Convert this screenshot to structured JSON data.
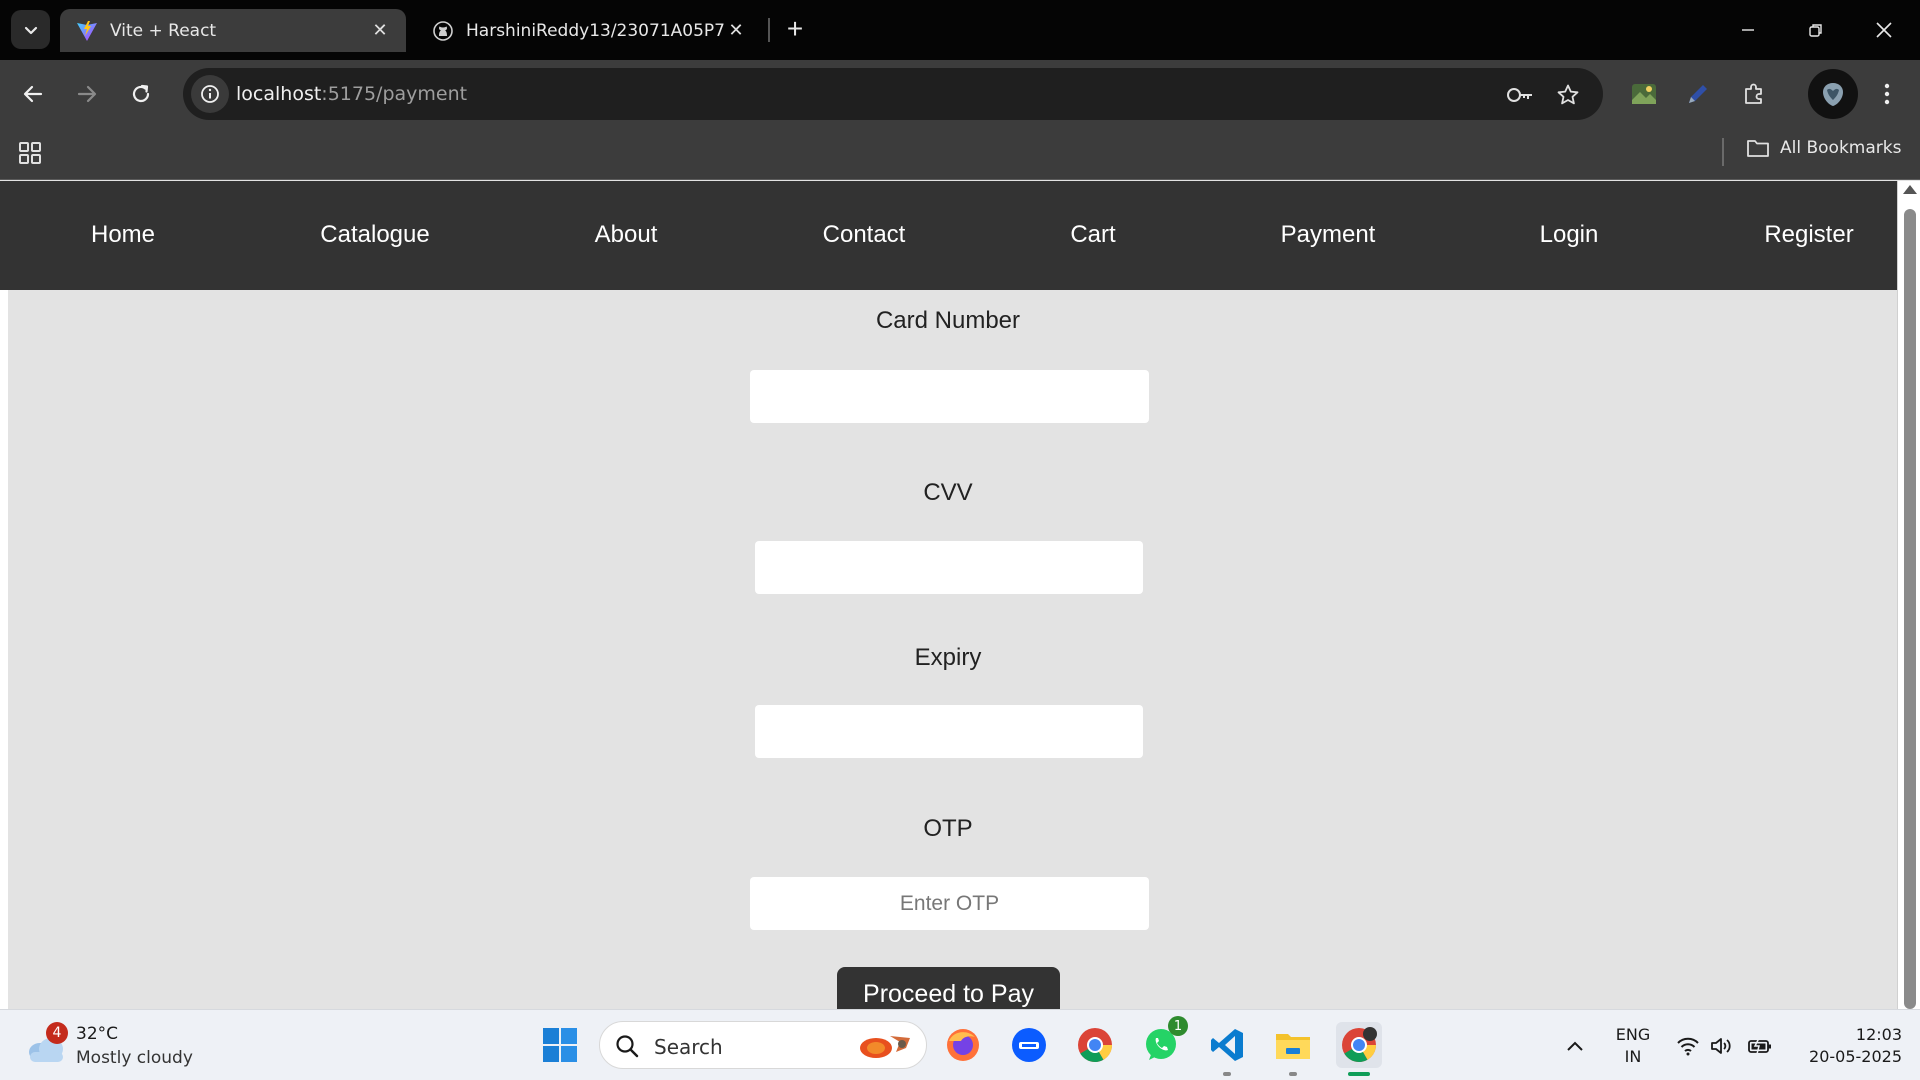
{
  "browser": {
    "tabs": [
      {
        "title": "Vite + React",
        "active": true,
        "icon": "vite-icon"
      },
      {
        "title": "HarshiniReddy13/23071A05P7_",
        "active": false,
        "icon": "github-icon"
      }
    ],
    "url": {
      "host": "localhost",
      "path": ":5175/payment"
    },
    "bookmarks": {
      "all_label": "All Bookmarks"
    }
  },
  "navbar": {
    "links": [
      {
        "label": "Home"
      },
      {
        "label": "Catalogue"
      },
      {
        "label": "About"
      },
      {
        "label": "Contact"
      },
      {
        "label": "Cart"
      },
      {
        "label": "Payment"
      },
      {
        "label": "Login"
      },
      {
        "label": "Register"
      }
    ]
  },
  "form": {
    "card_number": {
      "label": "Card Number",
      "value": "",
      "placeholder": ""
    },
    "cvv": {
      "label": "CVV",
      "value": "",
      "placeholder": ""
    },
    "expiry": {
      "label": "Expiry",
      "value": "",
      "placeholder": ""
    },
    "otp": {
      "label": "OTP",
      "value": "",
      "placeholder": "Enter OTP"
    },
    "submit_label": "Proceed to Pay"
  },
  "taskbar": {
    "weather": {
      "temp": "32°C",
      "condition": "Mostly cloudy",
      "badge": "4"
    },
    "search_label": "Search",
    "whatsapp_badge": "1",
    "language": {
      "line1": "ENG",
      "line2": "IN"
    },
    "clock": {
      "time": "12:03",
      "date": "20-05-2025"
    }
  },
  "colors": {
    "navbar_bg": "#333333",
    "page_bg": "#e3e3e3",
    "button_bg": "#333333",
    "chrome_dark": "#3c3c3c"
  }
}
